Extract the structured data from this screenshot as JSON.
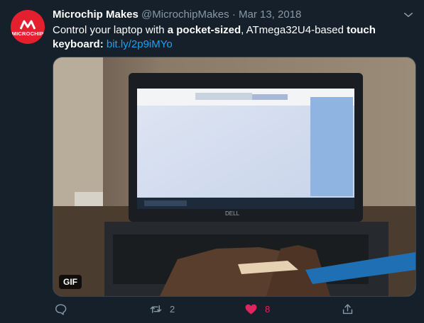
{
  "tweet": {
    "author_name": "Microchip Makes",
    "handle": "@MicrochipMakes",
    "separator": "·",
    "date": "Mar 13, 2018",
    "avatar_text": "MICROCHIP",
    "text_parts": [
      {
        "text": "Control your laptop with ",
        "bold": false
      },
      {
        "text": "a pocket-sized",
        "bold": true
      },
      {
        "text": ", ATmega32U4-based ",
        "bold": false
      },
      {
        "text": "touch keyboard:",
        "bold": true
      },
      {
        "text": " ",
        "bold": false
      }
    ],
    "link_text": "bit.ly/2p9iMYo",
    "media_badge": "GIF",
    "laptop_brand": "DELL"
  },
  "actions": {
    "reply_count": "",
    "retweet_count": "2",
    "like_count": "8",
    "share_count": ""
  },
  "colors": {
    "background": "#15202b",
    "secondary_text": "#8899a6",
    "link": "#1da1f2",
    "like": "#e0245e",
    "avatar": "#e4202e"
  }
}
